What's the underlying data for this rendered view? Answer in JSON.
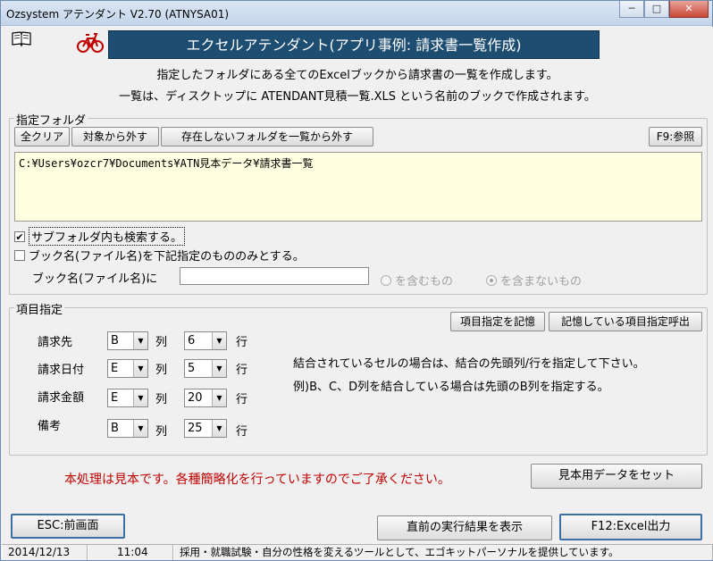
{
  "window": {
    "title": "Ozsystem アテンダント V2.70 (ATNYSA01)",
    "min_symbol": "─",
    "max_symbol": "□",
    "close_symbol": "✕"
  },
  "header": {
    "banner": "エクセルアテンダント(アプリ事例: 請求書一覧作成)",
    "desc1": "指定したフォルダにある全てのExcelブックから請求書の一覧を作成します。",
    "desc2": "一覧は、ディスクトップに ATENDANT見積一覧.XLS という名前のブックで作成されます。"
  },
  "folder_group": {
    "title": "指定フォルダ",
    "btn_clear": "全クリア",
    "btn_remove": "対象から外す",
    "btn_remove_missing": "存在しないフォルダを一覧から外す",
    "btn_browse": "F9:参照",
    "path": "C:¥Users¥ozcr7¥Documents¥ATN見本データ¥請求書一覧",
    "subfolder_check": "✔",
    "subfolder_label": "サブフォルダ内も検索する。",
    "bookname_label": "ブック名(ファイル名)を下記指定のもののみとする。",
    "bookname_field_label": "ブック名(ファイル名)に",
    "bookname_value": "",
    "radio_include": "を含むもの",
    "radio_exclude": "を含まないもの"
  },
  "items_group": {
    "title": "項目指定",
    "btn_save": "項目指定を記憶",
    "btn_recall": "記憶している項目指定呼出",
    "col_label": "列",
    "row_label": "行",
    "rows": [
      {
        "label": "請求先",
        "col": "B",
        "row": "6"
      },
      {
        "label": "請求日付",
        "col": "E",
        "row": "5"
      },
      {
        "label": "請求金額",
        "col": "E",
        "row": "20"
      },
      {
        "label": "備考",
        "col": "B",
        "row": "25"
      }
    ],
    "note1": "結合されているセルの場合は、結合の先頭列/行を指定して下さい。",
    "note2": "例)B、C、D列を結合している場合は先頭のB列を指定する。"
  },
  "footer": {
    "notice": "本処理は見本です。各種簡略化を行っていますのでご了承ください。",
    "btn_sample": "見本用データをセット",
    "btn_back": "ESC:前画面",
    "btn_last_result": "直前の実行結果を表示",
    "btn_excel": "F12:Excel出力"
  },
  "status": {
    "date": "2014/12/13",
    "time": "11:04",
    "message": "採用・就職試験・自分の性格を変えるツールとして、エゴキットパーソナルを提供しています。"
  },
  "colors": {
    "banner_bg": "#1e4d72",
    "notice": "#c00000",
    "path_bg": "#ffffe1"
  }
}
